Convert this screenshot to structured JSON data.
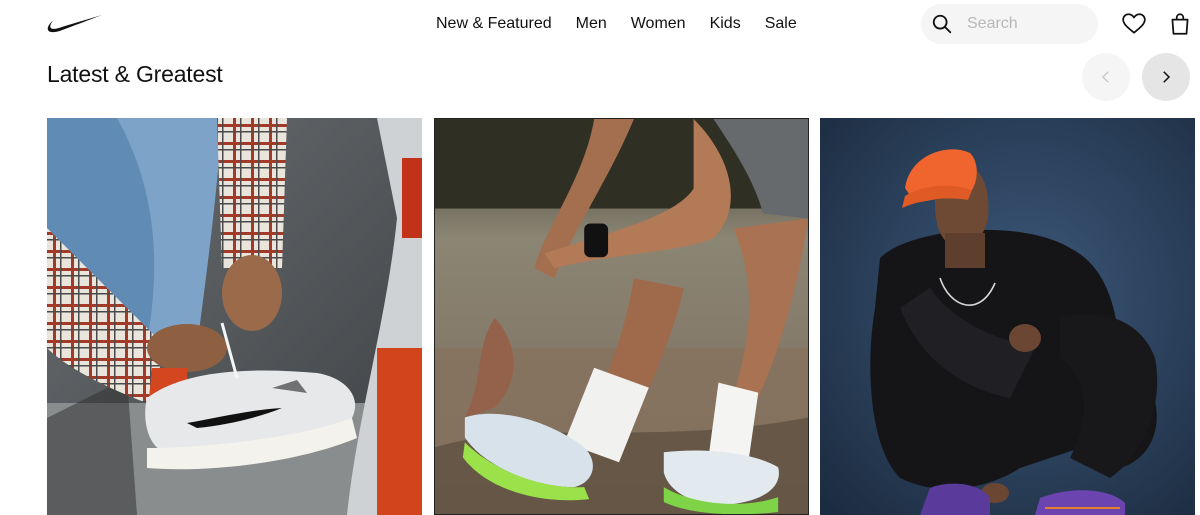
{
  "header": {
    "logo": "nike-swoosh-logo",
    "nav": [
      "New & Featured",
      "Men",
      "Women",
      "Kids",
      "Sale"
    ],
    "search": {
      "placeholder": "Search",
      "value": ""
    },
    "icons": [
      "search-icon",
      "heart-icon",
      "bag-icon"
    ]
  },
  "section": {
    "title": "Latest & Greatest",
    "prev_icon": "chevron-left-icon",
    "next_icon": "chevron-right-icon",
    "prev_disabled": true
  },
  "cards": [
    {
      "image": "person-in-plaid-shirt-tying-white-sneaker"
    },
    {
      "image": "runner-stretching-in-white-running-shoes"
    },
    {
      "image": "person-in-orange-cap-crouching"
    }
  ],
  "colors": {
    "text": "#111111",
    "search_bg": "#f5f5f5",
    "prev_bg": "#f5f5f5",
    "next_bg": "#e5e5e5",
    "placeholder": "#b8b8b8"
  }
}
